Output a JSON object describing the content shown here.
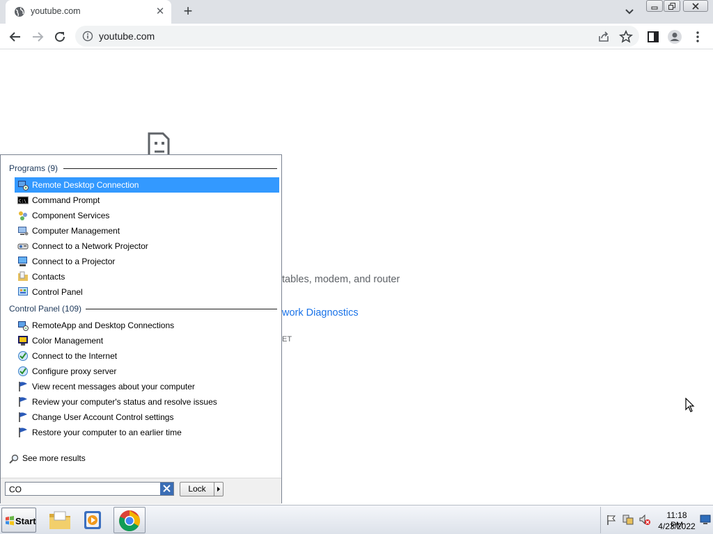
{
  "browser": {
    "tab_title": "youtube.com",
    "url": "youtube.com",
    "icons": [
      "globe-icon",
      "close-icon",
      "plus-icon",
      "chevron-down-icon",
      "back-arrow-icon",
      "forward-arrow-icon",
      "reload-icon",
      "info-icon",
      "share-icon",
      "star-icon",
      "side-panel-icon",
      "profile-icon",
      "kebab-menu-icon"
    ]
  },
  "page": {
    "line1": "tables, modem, and router",
    "link": "work Diagnostics",
    "code": "ET"
  },
  "start_menu": {
    "programs_header": "Programs (9)",
    "programs": [
      {
        "label": "Remote Desktop Connection",
        "icon": "remote-desktop-icon",
        "selected": true
      },
      {
        "label": "Command Prompt",
        "icon": "cmd-icon"
      },
      {
        "label": "Component Services",
        "icon": "component-services-icon"
      },
      {
        "label": "Computer Management",
        "icon": "computer-management-icon"
      },
      {
        "label": "Connect to a Network Projector",
        "icon": "network-projector-icon"
      },
      {
        "label": "Connect to a Projector",
        "icon": "projector-icon"
      },
      {
        "label": "Contacts",
        "icon": "contacts-folder-icon"
      },
      {
        "label": "Control Panel",
        "icon": "control-panel-icon"
      }
    ],
    "control_panel_header": "Control Panel (109)",
    "control_panel": [
      {
        "label": "RemoteApp and Desktop Connections",
        "icon": "remoteapp-icon"
      },
      {
        "label": "Color Management",
        "icon": "color-management-icon"
      },
      {
        "label": "Connect to the Internet",
        "icon": "internet-options-icon"
      },
      {
        "label": "Configure proxy server",
        "icon": "internet-options-icon"
      },
      {
        "label": "View recent messages about your computer",
        "icon": "flag-icon"
      },
      {
        "label": "Review your computer's status and resolve issues",
        "icon": "flag-icon"
      },
      {
        "label": "Change User Account Control settings",
        "icon": "flag-icon"
      },
      {
        "label": "Restore your computer to an earlier time",
        "icon": "flag-icon"
      }
    ],
    "see_more": "See more results",
    "search_value": "CO",
    "lock_label": "Lock"
  },
  "taskbar": {
    "start_label": "Start",
    "apps": [
      "explorer-icon",
      "media-player-icon",
      "chrome-icon"
    ],
    "time": "11:18 PM",
    "date": "4/23/2022"
  },
  "colors": {
    "selection": "#3399ff",
    "link": "#1a73e8",
    "tab_strip": "#dee1e6"
  }
}
